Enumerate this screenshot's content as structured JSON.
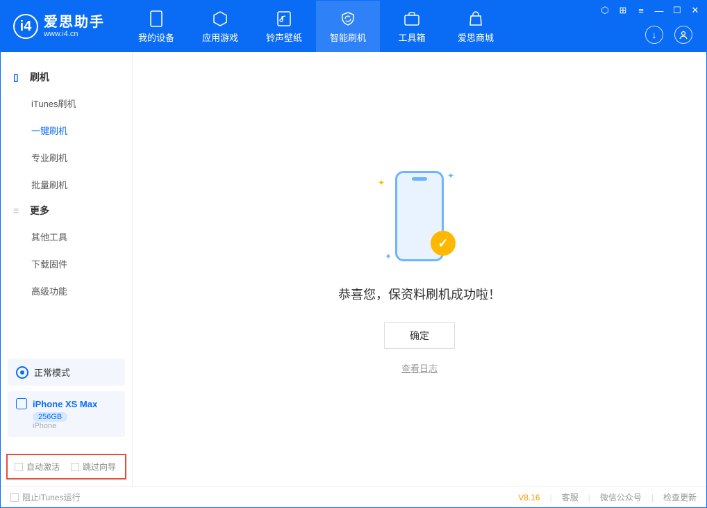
{
  "app": {
    "title": "爱思助手",
    "url": "www.i4.cn"
  },
  "nav": [
    {
      "label": "我的设备"
    },
    {
      "label": "应用游戏"
    },
    {
      "label": "铃声壁纸"
    },
    {
      "label": "智能刷机",
      "active": true
    },
    {
      "label": "工具箱"
    },
    {
      "label": "爱思商城"
    }
  ],
  "sidebar": {
    "flash_header": "刷机",
    "flash_items": [
      {
        "label": "iTunes刷机"
      },
      {
        "label": "一键刷机",
        "active": true
      },
      {
        "label": "专业刷机"
      },
      {
        "label": "批量刷机"
      }
    ],
    "more_header": "更多",
    "more_items": [
      {
        "label": "其他工具"
      },
      {
        "label": "下载固件"
      },
      {
        "label": "高级功能"
      }
    ],
    "mode": "正常模式",
    "device": {
      "name": "iPhone XS Max",
      "capacity": "256GB",
      "type": "iPhone"
    },
    "checkboxes": {
      "auto_activate": "自动激活",
      "skip_guide": "跳过向导"
    }
  },
  "main": {
    "message": "恭喜您，保资料刷机成功啦！",
    "confirm": "确定",
    "view_log": "查看日志"
  },
  "footer": {
    "block_itunes": "阻止iTunes运行",
    "version": "V8.16",
    "support": "客服",
    "wechat": "微信公众号",
    "check_update": "检查更新"
  }
}
